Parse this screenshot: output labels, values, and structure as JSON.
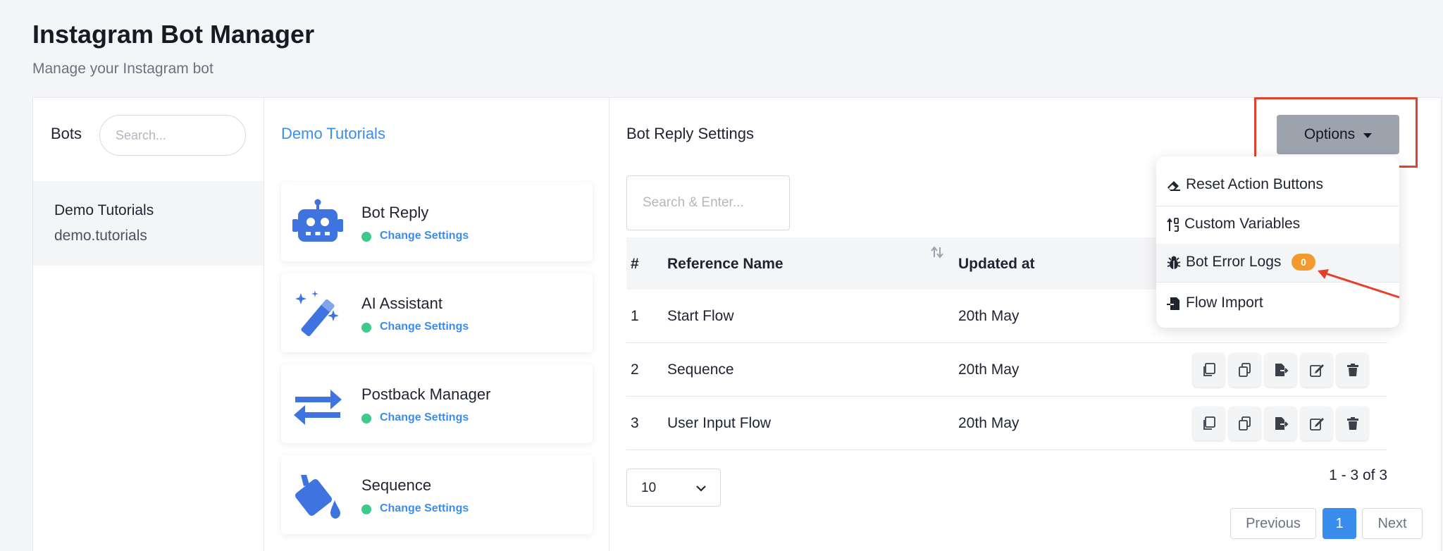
{
  "header": {
    "title": "Instagram Bot Manager",
    "subtitle": "Manage your Instagram bot"
  },
  "bots_panel": {
    "label": "Bots",
    "search_placeholder": "Search...",
    "items": [
      {
        "name": "Demo Tutorials",
        "handle": "demo.tutorials"
      }
    ]
  },
  "features_panel": {
    "title": "Demo Tutorials",
    "items": [
      {
        "name": "Bot Reply",
        "link": "Change Settings",
        "icon": "robot-icon",
        "status_color": "#3fc98a"
      },
      {
        "name": "AI Assistant",
        "link": "Change Settings",
        "icon": "magic-wand-icon",
        "status_color": "#3fc98a"
      },
      {
        "name": "Postback Manager",
        "link": "Change Settings",
        "icon": "exchange-arrows-icon",
        "status_color": "#3fc98a"
      },
      {
        "name": "Sequence",
        "link": "Change Settings",
        "icon": "paint-bucket-icon",
        "status_color": "#3fc98a"
      }
    ]
  },
  "main": {
    "title": "Bot Reply Settings",
    "search_placeholder": "Search & Enter...",
    "table": {
      "columns": [
        "#",
        "Reference Name",
        "Updated at"
      ],
      "rows": [
        {
          "num": "1",
          "name": "Start Flow",
          "updated": "20th May"
        },
        {
          "num": "2",
          "name": "Sequence",
          "updated": "20th May"
        },
        {
          "num": "3",
          "name": "User Input Flow",
          "updated": "20th May"
        }
      ],
      "row_actions": [
        "copy-icon",
        "clone-icon",
        "export-icon",
        "edit-icon",
        "trash-icon"
      ]
    },
    "per_page": "10",
    "range_text": "1 - 3 of 3",
    "pagination": {
      "previous": "Previous",
      "current": "1",
      "next": "Next"
    }
  },
  "options": {
    "label": "Options",
    "menu": [
      {
        "label": "Reset Action Buttons",
        "icon": "eraser-icon"
      },
      {
        "label": "Custom Variables",
        "icon": "sort-variables-icon"
      },
      {
        "label": "Bot Error Logs",
        "icon": "bug-icon",
        "badge": "0"
      },
      {
        "label": "Flow Import",
        "icon": "file-import-icon"
      }
    ]
  },
  "colors": {
    "accent": "#3b8ded",
    "status_green": "#3fc98a",
    "highlight_red": "#e4412c",
    "badge_orange": "#f39a2e",
    "options_button": "#9ca3ad"
  }
}
